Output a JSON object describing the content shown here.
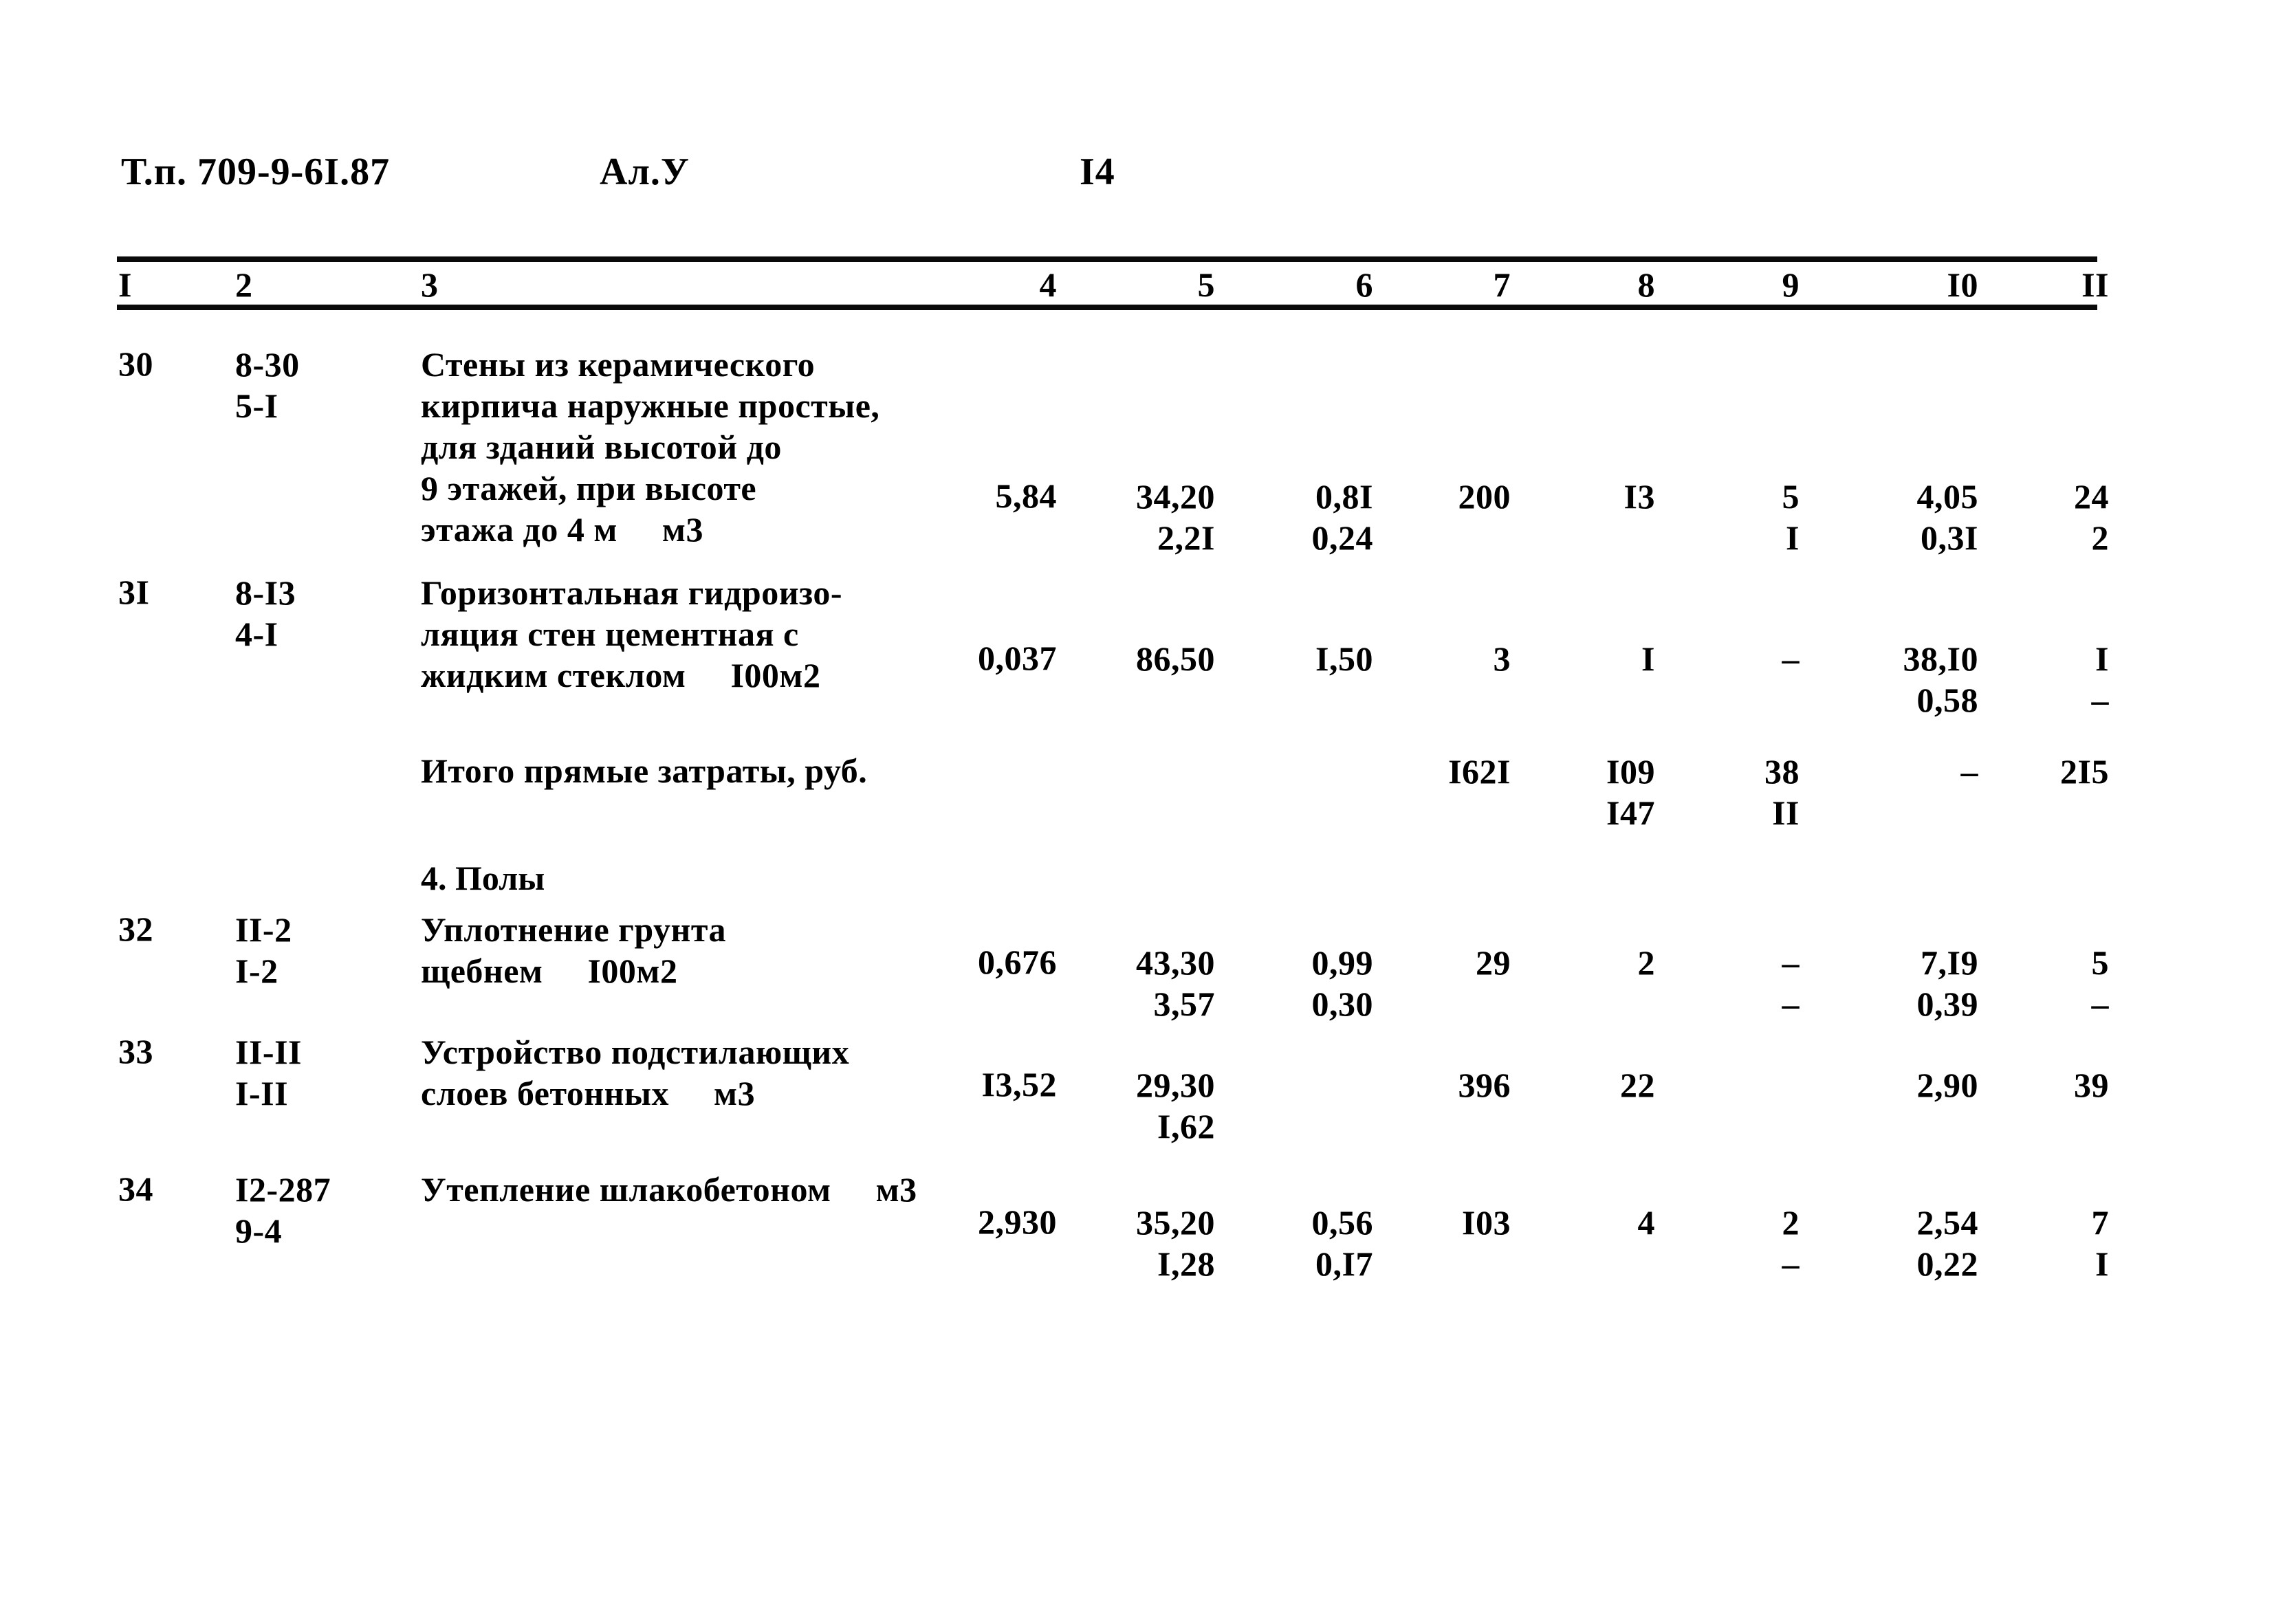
{
  "header": {
    "doc_code": "Т.п.  709-9-6I.87",
    "album": "Ал.У",
    "page": "I4"
  },
  "table": {
    "column_headers": [
      "I",
      "2",
      "3",
      "4",
      "5",
      "6",
      "7",
      "8",
      "9",
      "I0",
      "II"
    ],
    "rows": [
      {
        "kind": "item",
        "no": "30",
        "code_top": "8-30",
        "code_bottom": "5-I",
        "desc_lines": [
          "Стены из керамического",
          "кирпича наружные простые,",
          "для зданий высотой до",
          "9 этажей, при высоте",
          "этажа до 4 м"
        ],
        "unit": "м3",
        "c4": "5,84",
        "c5_top": "34,20",
        "c5_bot": "2,2I",
        "c6_top": "0,8I",
        "c6_bot": "0,24",
        "c7_top": "200",
        "c7_bot": "",
        "c8_top": "I3",
        "c8_bot": "",
        "c9_top": "5",
        "c9_bot": "I",
        "c10_top": "4,05",
        "c10_bot": "0,3I",
        "c11_top": "24",
        "c11_bot": "2"
      },
      {
        "kind": "item",
        "no": "3I",
        "code_top": "8-I3",
        "code_bottom": "4-I",
        "desc_lines": [
          "Горизонтальная гидроизо-",
          "ляция стен цементная с",
          "жидким стеклом"
        ],
        "unit": "I00м2",
        "c4": "0,037",
        "c5_top": "86,50",
        "c5_bot": "",
        "c6_top": "I,50",
        "c6_bot": "",
        "c7_top": "3",
        "c7_bot": "",
        "c8_top": "I",
        "c8_bot": "",
        "c9_top": "–",
        "c9_bot": "",
        "c10_top": "38,I0",
        "c10_bot": "0,58",
        "c11_top": "I",
        "c11_bot": "–"
      },
      {
        "kind": "total",
        "label": "Итого прямые затраты, руб.",
        "c7_top": "I62I",
        "c7_bot": "",
        "c8_top": "I09",
        "c8_bot": "I47",
        "c9_top": "38",
        "c9_bot": "II",
        "c10_top": "–",
        "c10_bot": "",
        "c11_top": "2I5",
        "c11_bot": ""
      },
      {
        "kind": "section",
        "title": "4. Полы"
      },
      {
        "kind": "item",
        "no": "32",
        "code_top": "II-2",
        "code_bottom": "I-2",
        "desc_lines": [
          "Уплотнение грунта",
          "щебнем"
        ],
        "unit": "I00м2",
        "c4": "0,676",
        "c5_top": "43,30",
        "c5_bot": "3,57",
        "c6_top": "0,99",
        "c6_bot": "0,30",
        "c7_top": "29",
        "c7_bot": "",
        "c8_top": "2",
        "c8_bot": "",
        "c9_top": "–",
        "c9_bot": "–",
        "c10_top": "7,I9",
        "c10_bot": "0,39",
        "c11_top": "5",
        "c11_bot": "–"
      },
      {
        "kind": "item",
        "no": "33",
        "code_top": "II-II",
        "code_bottom": "I-II",
        "desc_lines": [
          "Устройство подстилающих",
          "слоев бетонных"
        ],
        "unit": "м3",
        "c4": "I3,52",
        "c5_top": "29,30",
        "c5_bot": "I,62",
        "c6_top": "",
        "c6_bot": "",
        "c7_top": "396",
        "c7_bot": "",
        "c8_top": "22",
        "c8_bot": "",
        "c9_top": "",
        "c9_bot": "",
        "c10_top": "2,90",
        "c10_bot": "",
        "c11_top": "39",
        "c11_bot": ""
      },
      {
        "kind": "item",
        "no": "34",
        "code_top": "I2-287",
        "code_bottom": "9-4",
        "desc_lines": [
          "Утепление шлакобетоном"
        ],
        "unit": "м3",
        "c4": "2,930",
        "c5_top": "35,20",
        "c5_bot": "I,28",
        "c6_top": "0,56",
        "c6_bot": "0,I7",
        "c7_top": "I03",
        "c7_bot": "",
        "c8_top": "4",
        "c8_bot": "",
        "c9_top": "2",
        "c9_bot": "–",
        "c10_top": "2,54",
        "c10_bot": "0,22",
        "c11_top": "7",
        "c11_bot": "I"
      }
    ]
  }
}
